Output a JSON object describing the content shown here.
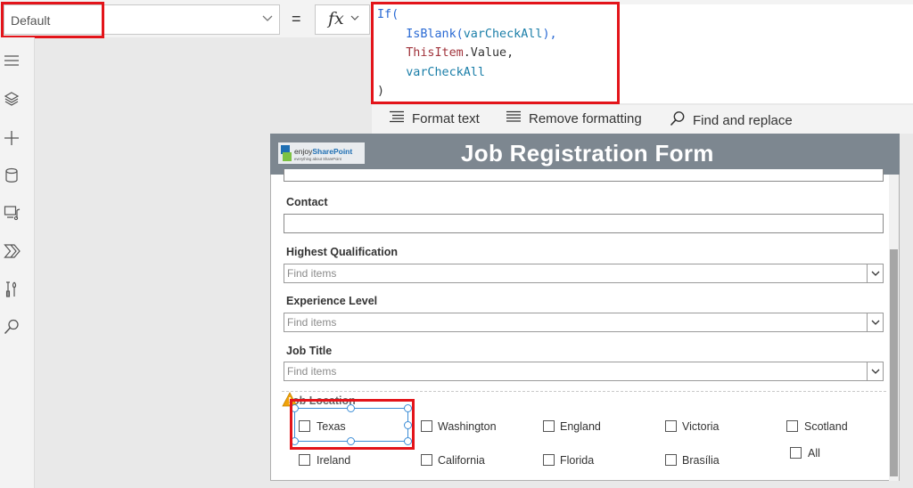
{
  "formula_bar": {
    "property_value": "Default",
    "equals": "=",
    "fx": "fx",
    "formula": {
      "line1_keyword": "If(",
      "line2_fn": "IsBlank(",
      "line2_var": "varCheckAll",
      "line2_end": "),",
      "line3_ctx": "ThisItem",
      "line3_rest": ".Value,",
      "line4_var": "varCheckAll",
      "line5": ")"
    },
    "toolbar": {
      "format_text": "Format text",
      "remove_formatting": "Remove formatting",
      "find_and_replace": "Find and replace"
    }
  },
  "left_rail": {
    "icons": [
      "hamburger-menu-icon",
      "layers-icon",
      "add-icon",
      "data-icon",
      "media-icon",
      "power-automate-icon",
      "tools-icon",
      "search-icon"
    ]
  },
  "form": {
    "title": "Job Registration Form",
    "logo": {
      "brand_prefix": "enjoy",
      "brand_name": "SharePoint",
      "tagline": "everything about SharePoint"
    },
    "fields": {
      "contact_label": "Contact",
      "qualification_label": "Highest Qualification",
      "qualification_placeholder": "Find items",
      "experience_label": "Experience Level",
      "experience_placeholder": "Find items",
      "job_title_label": "Job Title",
      "job_title_placeholder": "Find items",
      "job_location_label": "Job Location"
    },
    "locations": {
      "texas": "Texas",
      "washington": "Washington",
      "england": "England",
      "victoria": "Victoria",
      "scotland": "Scotland",
      "ireland": "Ireland",
      "california": "California",
      "florida": "Florida",
      "brasilia": "Brasília",
      "all": "All"
    }
  },
  "colors": {
    "highlight_red": "#e3141a",
    "header_gray": "#7d8790",
    "selection_blue": "#3c8dd6",
    "warning_orange": "#f0a30a"
  }
}
